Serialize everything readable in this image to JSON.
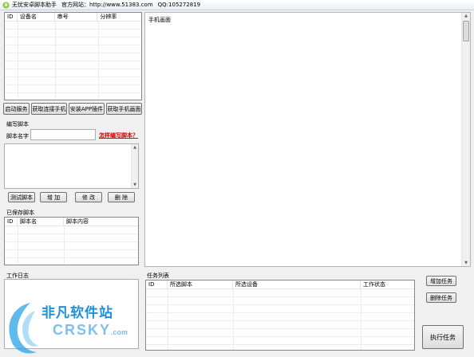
{
  "window": {
    "title": "无忧安卓脚本助手",
    "site": "官方网站：http://www.51383.com",
    "qq": "QQ:105272819"
  },
  "devices": {
    "columns": [
      "ID",
      "设备名",
      "串号",
      "分辨率"
    ]
  },
  "toolbar": {
    "start_service": "启动服务",
    "get_phones": "获取连接手机",
    "install_app": "安装APP插件",
    "get_screen": "获取手机画面"
  },
  "script_editor": {
    "group_title": "编写脚本",
    "name_label": "脚本名字",
    "name_value": "",
    "help_link": "怎样编写脚本？",
    "content": "",
    "buttons": {
      "test": "测试脚本",
      "add": "增 加",
      "edit": "修 改",
      "delete": "删 除"
    }
  },
  "saved_scripts": {
    "title": "已保存脚本",
    "columns": [
      "ID",
      "脚本名",
      "脚本内容"
    ]
  },
  "work_log": {
    "title": "工作日志",
    "content": ""
  },
  "phone_screen": {
    "title": "手机画面"
  },
  "tasks": {
    "title": "任务列表",
    "columns": [
      "ID",
      "所选脚本",
      "所选设备",
      "工作状态"
    ],
    "add_button": "增加任务",
    "delete_button": "删除任务",
    "run_button": "执行任务"
  },
  "watermark": {
    "cn": "非凡软件站",
    "en": "CRSKY",
    "en_suffix": ".com"
  },
  "colors": {
    "link": "#e00000",
    "watermark_blue": "#1f8fd6"
  }
}
